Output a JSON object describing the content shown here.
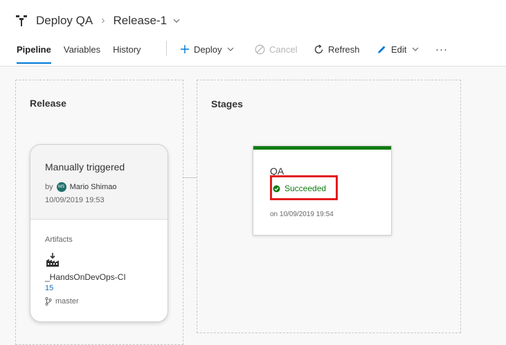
{
  "header": {
    "pipeline_name": "Deploy QA",
    "release_name": "Release-1"
  },
  "tabs": [
    {
      "label": "Pipeline",
      "active": true
    },
    {
      "label": "Variables",
      "active": false
    },
    {
      "label": "History",
      "active": false
    }
  ],
  "toolbar": {
    "deploy_label": "Deploy",
    "cancel_label": "Cancel",
    "refresh_label": "Refresh",
    "edit_label": "Edit",
    "more_label": "···"
  },
  "release_panel": {
    "title": "Release",
    "trigger": {
      "heading": "Manually triggered",
      "by_prefix": "by",
      "avatar_initials": "MS",
      "user": "Mario Shimao",
      "date": "10/09/2019 19:53"
    },
    "artifacts": {
      "label": "Artifacts",
      "name": "_HandsOnDevOps-CI",
      "version": "15",
      "branch": "master"
    }
  },
  "stages_panel": {
    "title": "Stages",
    "stage": {
      "name": "QA",
      "status": "Succeeded",
      "date": "on 10/09/2019 19:54"
    }
  },
  "colors": {
    "accent": "#0078d4",
    "success": "#107c10",
    "highlight": "#e31c1c"
  }
}
